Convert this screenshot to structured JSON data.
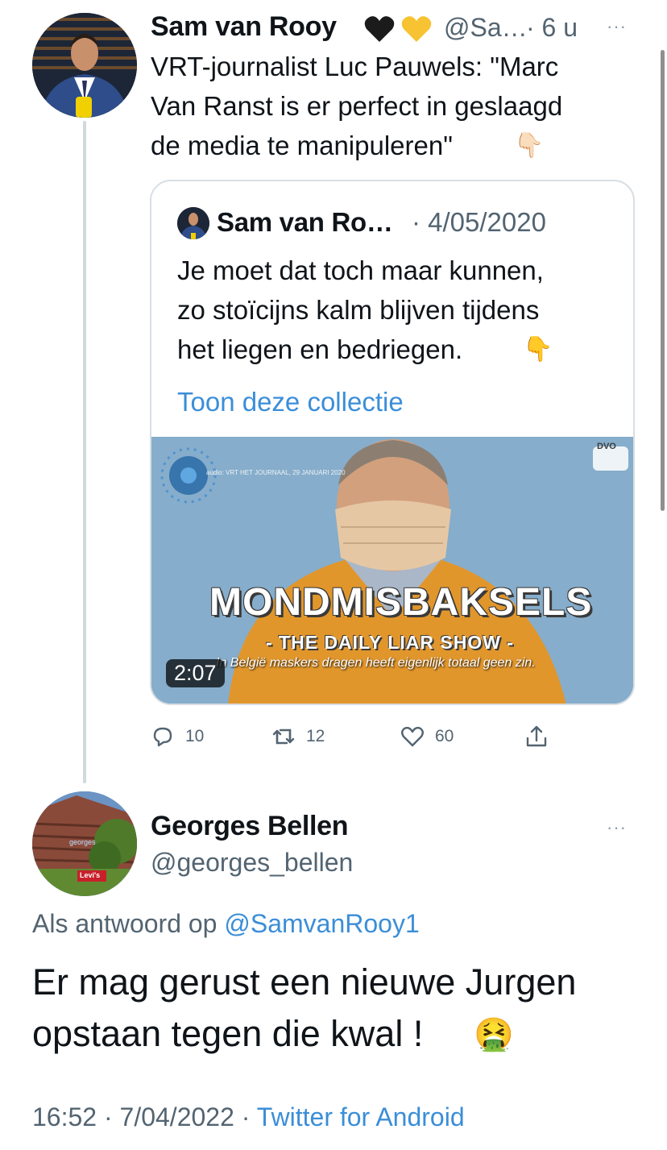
{
  "original_tweet": {
    "author_name": "Sam van Rooy",
    "badges": [
      "🖤",
      "💛"
    ],
    "handle": "@Sa…",
    "age": "· 6 u",
    "more": "···",
    "text_line1": "VRT-journalist Luc Pauwels: \"Marc",
    "text_line2": "Van Ranst is er perfect in geslaagd",
    "text_line3": "de media te manipuleren\"",
    "text_emoji": "👇🏻"
  },
  "quoted_tweet": {
    "author_name": "Sam van Ro…",
    "date": "· 4/05/2020",
    "text_line1": "Je moet dat toch maar kunnen,",
    "text_line2": "zo stoïcijns kalm blijven tijdens",
    "text_line3": "het liegen en bedriegen.",
    "text_emoji": "👇",
    "collection_link": "Toon deze collectie",
    "video": {
      "audio_credit": "audio: VRT HET JOURNAAL, 29 JANUARI 2020",
      "title": "MONDMISBAKSELS",
      "subtitle": "- THE DAILY LIAR SHOW -",
      "caption": "In België maskers dragen heeft eigenlijk totaal geen zin.",
      "watermark": "DVO",
      "duration": "2:07"
    }
  },
  "actions": {
    "reply_count": "10",
    "retweet_count": "12",
    "like_count": "60"
  },
  "reply_tweet": {
    "author_name": "Georges Bellen",
    "handle": "@georges_bellen",
    "more": "···",
    "reply_prefix": "Als antwoord op",
    "reply_handle": "@SamvanRooy1",
    "text_line1": "Er mag gerust een nieuwe Jurgen",
    "text_line2": "opstaan tegen die kwal !",
    "text_emoji": "🤮",
    "avatar_sign": "Levi's",
    "avatar_text": "georges"
  },
  "footer": {
    "time_date": "16:52 · 7/04/2022 ·",
    "client": "Twitter for Android"
  },
  "colors": {
    "link": "#3b8ed8",
    "secondary_text": "#536471",
    "border": "#d8dee3"
  }
}
